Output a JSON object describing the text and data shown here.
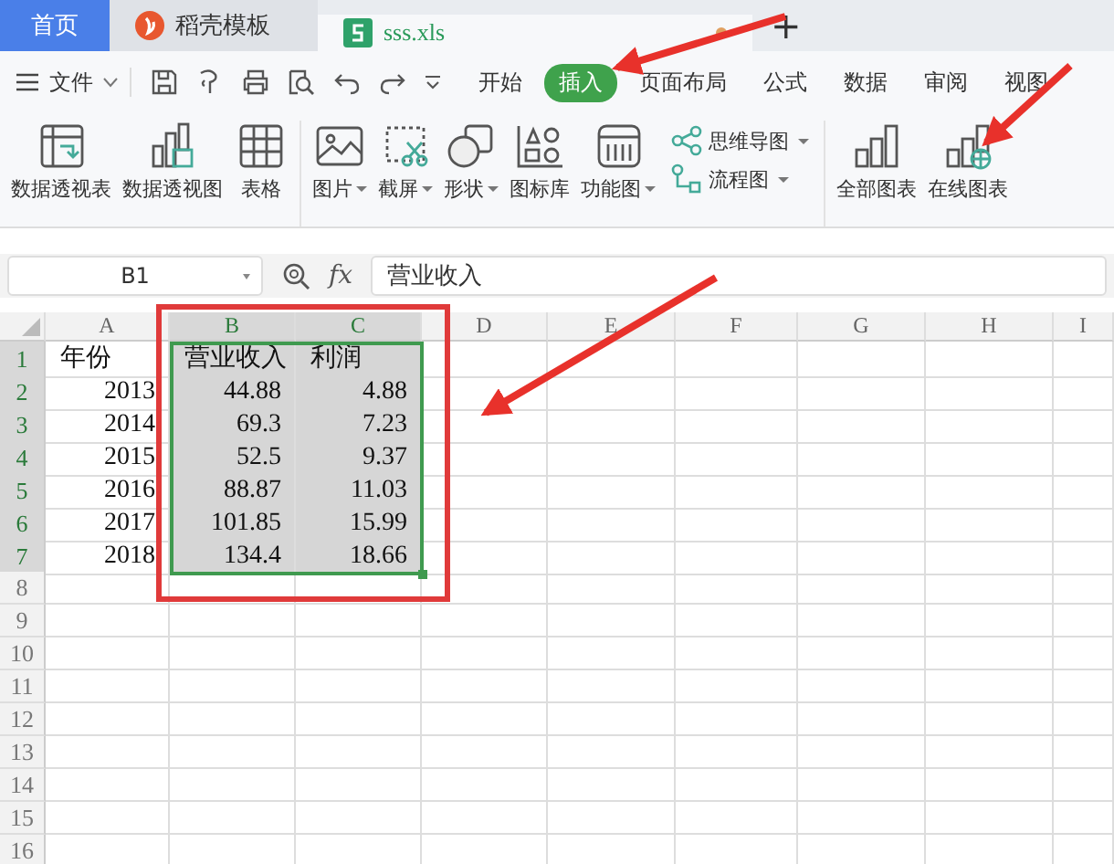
{
  "tabs": [
    {
      "label": "首页",
      "kind": "home",
      "selected": false
    },
    {
      "label": "稻壳模板",
      "kind": "docer",
      "selected": false
    },
    {
      "label": "sss.xls",
      "kind": "sheet",
      "selected": true
    }
  ],
  "new_tab": "+",
  "menu": {
    "file": "文件",
    "tabs": [
      {
        "label": "开始",
        "selected": false
      },
      {
        "label": "插入",
        "selected": true
      },
      {
        "label": "页面布局",
        "selected": false
      },
      {
        "label": "公式",
        "selected": false
      },
      {
        "label": "数据",
        "selected": false
      },
      {
        "label": "审阅",
        "selected": false
      },
      {
        "label": "视图",
        "selected": false
      }
    ]
  },
  "ribbon": {
    "groups": [
      [
        {
          "label": "数据透视表",
          "kind": "pivot_table",
          "dropdown": false
        },
        {
          "label": "数据透视图",
          "kind": "pivot_chart",
          "dropdown": false
        },
        {
          "label": "表格",
          "kind": "table",
          "dropdown": false
        }
      ],
      [
        {
          "label": "图片",
          "kind": "picture",
          "dropdown": true
        },
        {
          "label": "截屏",
          "kind": "screenshot",
          "dropdown": true
        },
        {
          "label": "形状",
          "kind": "shapes",
          "dropdown": true
        },
        {
          "label": "图标库",
          "kind": "icons",
          "dropdown": false
        },
        {
          "label": "功能图",
          "kind": "function_chart",
          "dropdown": true
        },
        {
          "kind": "stack",
          "items": [
            {
              "label": "思维导图",
              "kind": "mindmap",
              "dropdown": true
            },
            {
              "label": "流程图",
              "kind": "flowchart",
              "dropdown": true
            }
          ]
        }
      ],
      [
        {
          "label": "全部图表",
          "kind": "all_charts",
          "dropdown": false
        },
        {
          "label": "在线图表",
          "kind": "online_charts",
          "dropdown": false
        }
      ]
    ]
  },
  "formula_bar": {
    "name_box": "B1",
    "fx": "fx",
    "value": "营业收入"
  },
  "sheet": {
    "columns": [
      {
        "label": "A",
        "selected": false
      },
      {
        "label": "B",
        "selected": true
      },
      {
        "label": "C",
        "selected": true
      },
      {
        "label": "D",
        "selected": false
      },
      {
        "label": "E",
        "selected": false
      },
      {
        "label": "F",
        "selected": false
      },
      {
        "label": "G",
        "selected": false
      },
      {
        "label": "H",
        "selected": false
      },
      {
        "label": "I",
        "selected": false
      }
    ],
    "rows": [
      {
        "label": "1",
        "selected": true,
        "cells": [
          {
            "text": "年份",
            "numeric": false
          },
          {
            "text": "营业收入",
            "numeric": false
          },
          {
            "text": "利润",
            "numeric": false
          }
        ]
      },
      {
        "label": "2",
        "selected": true,
        "cells": [
          {
            "text": "2013",
            "numeric": true
          },
          {
            "text": "44.88",
            "numeric": true
          },
          {
            "text": "4.88",
            "numeric": true
          }
        ]
      },
      {
        "label": "3",
        "selected": true,
        "cells": [
          {
            "text": "2014",
            "numeric": true
          },
          {
            "text": "69.3",
            "numeric": true
          },
          {
            "text": "7.23",
            "numeric": true
          }
        ]
      },
      {
        "label": "4",
        "selected": true,
        "cells": [
          {
            "text": "2015",
            "numeric": true
          },
          {
            "text": "52.5",
            "numeric": true
          },
          {
            "text": "9.37",
            "numeric": true
          }
        ]
      },
      {
        "label": "5",
        "selected": true,
        "cells": [
          {
            "text": "2016",
            "numeric": true
          },
          {
            "text": "88.87",
            "numeric": true
          },
          {
            "text": "11.03",
            "numeric": true
          }
        ]
      },
      {
        "label": "6",
        "selected": true,
        "cells": [
          {
            "text": "2017",
            "numeric": true
          },
          {
            "text": "101.85",
            "numeric": true
          },
          {
            "text": "15.99",
            "numeric": true
          }
        ]
      },
      {
        "label": "7",
        "selected": true,
        "cells": [
          {
            "text": "2018",
            "numeric": true
          },
          {
            "text": "134.4",
            "numeric": true
          },
          {
            "text": "18.66",
            "numeric": true
          }
        ]
      },
      {
        "label": "8",
        "selected": false,
        "cells": []
      },
      {
        "label": "9",
        "selected": false,
        "cells": []
      },
      {
        "label": "10",
        "selected": false,
        "cells": []
      },
      {
        "label": "11",
        "selected": false,
        "cells": []
      },
      {
        "label": "12",
        "selected": false,
        "cells": []
      },
      {
        "label": "13",
        "selected": false,
        "cells": []
      },
      {
        "label": "14",
        "selected": false,
        "cells": []
      },
      {
        "label": "15",
        "selected": false,
        "cells": []
      },
      {
        "label": "16",
        "selected": false,
        "cells": []
      }
    ]
  }
}
